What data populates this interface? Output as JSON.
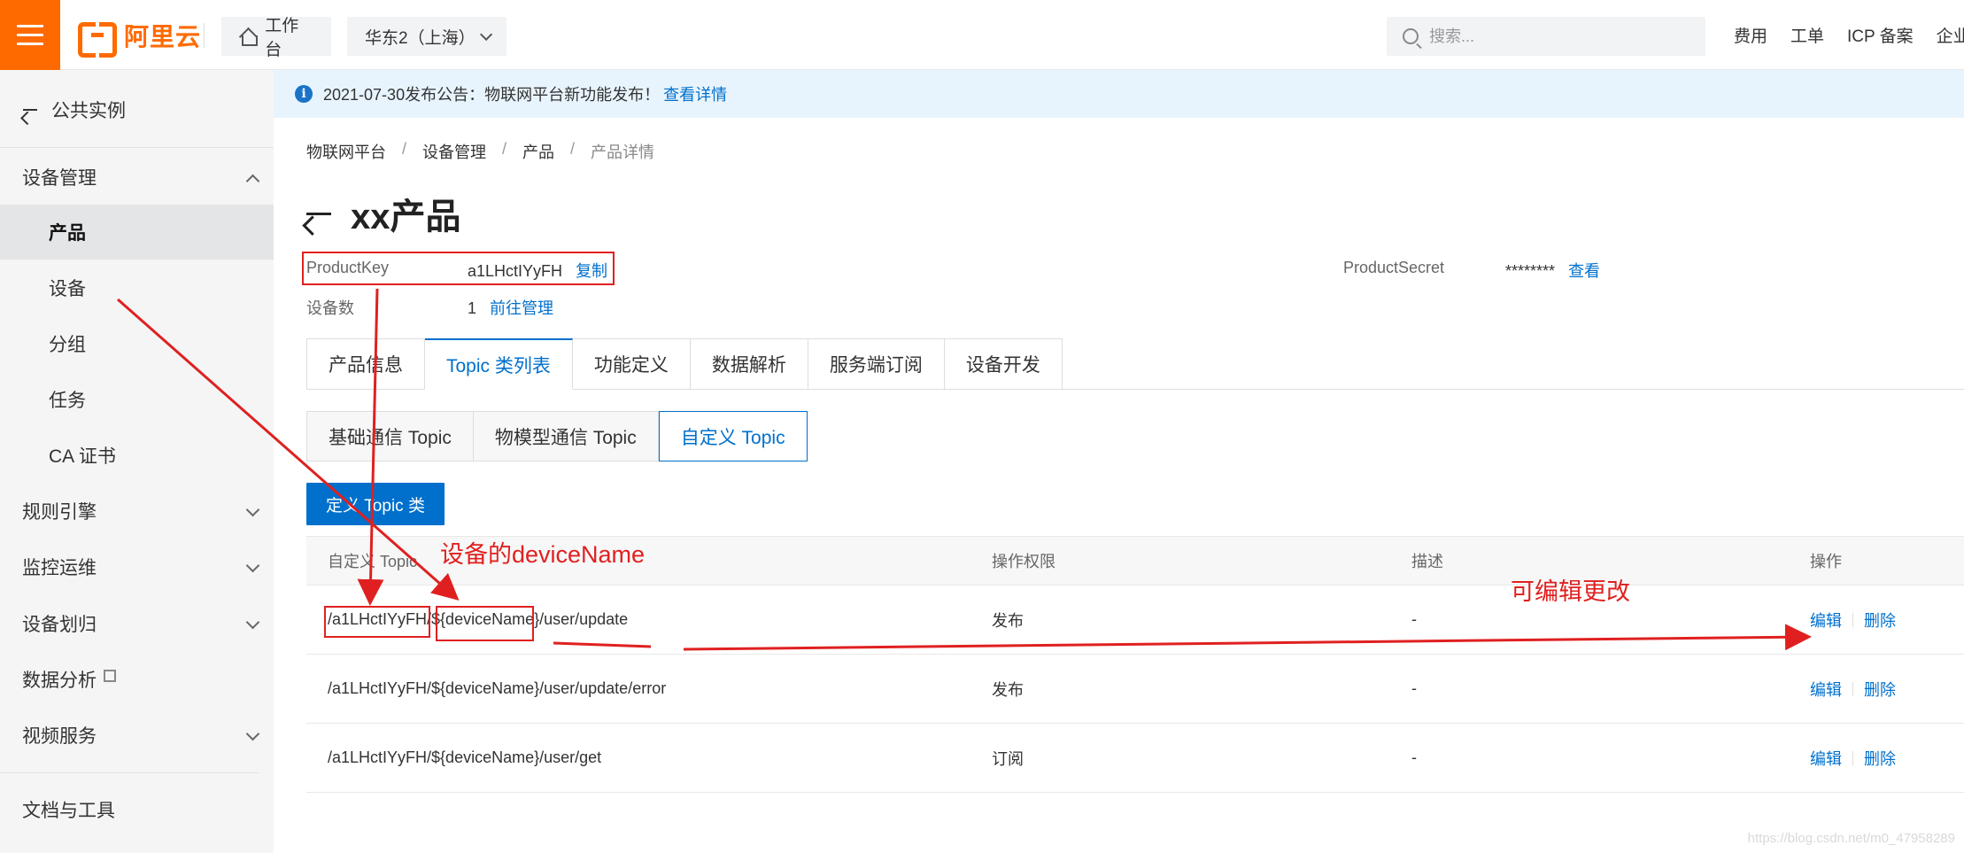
{
  "topbar": {
    "logo_text": "阿里云",
    "home_label": "工作台",
    "region_label": "华东2（上海）",
    "search_placeholder": "搜索...",
    "links": [
      "费用",
      "工单",
      "ICP 备案",
      "企业"
    ]
  },
  "sidebar": {
    "back_label": "公共实例",
    "items": [
      {
        "label": "设备管理",
        "kind": "group",
        "chevron": "up"
      },
      {
        "label": "产品",
        "kind": "sub",
        "active": true
      },
      {
        "label": "设备",
        "kind": "sub"
      },
      {
        "label": "分组",
        "kind": "sub"
      },
      {
        "label": "任务",
        "kind": "sub"
      },
      {
        "label": "CA 证书",
        "kind": "sub"
      },
      {
        "label": "规则引擎",
        "kind": "group",
        "chevron": "down"
      },
      {
        "label": "监控运维",
        "kind": "group",
        "chevron": "down"
      },
      {
        "label": "设备划归",
        "kind": "group",
        "chevron": "down"
      },
      {
        "label": "数据分析",
        "kind": "group",
        "external": true
      },
      {
        "label": "视频服务",
        "kind": "group",
        "chevron": "down"
      },
      {
        "label": "文档与工具",
        "kind": "group"
      }
    ]
  },
  "notice": {
    "text": "2021-07-30发布公告：物联网平台新功能发布！",
    "link": "查看详情"
  },
  "breadcrumb": [
    "物联网平台",
    "设备管理",
    "产品",
    "产品详情"
  ],
  "product": {
    "title": "xx产品",
    "product_key_label": "ProductKey",
    "product_key": "a1LHctIYyFH",
    "copy_label": "复制",
    "device_count_label": "设备数",
    "device_count": "1",
    "manage_link": "前往管理",
    "product_secret_label": "ProductSecret",
    "product_secret": "********",
    "view_label": "查看"
  },
  "tabs": [
    "产品信息",
    "Topic 类列表",
    "功能定义",
    "数据解析",
    "服务端订阅",
    "设备开发"
  ],
  "active_tab": 1,
  "subtabs": [
    "基础通信 Topic",
    "物模型通信 Topic",
    "自定义 Topic"
  ],
  "active_subtab": 2,
  "define_button": "定义 Topic 类",
  "table": {
    "headers": [
      "自定义 Topic",
      "操作权限",
      "描述",
      "操作"
    ],
    "rows": [
      {
        "topic": "/a1LHctIYyFH/${deviceName}/user/update",
        "perm": "发布",
        "desc": "-",
        "edit": "编辑",
        "del": "删除"
      },
      {
        "topic": "/a1LHctIYyFH/${deviceName}/user/update/error",
        "perm": "发布",
        "desc": "-",
        "edit": "编辑",
        "del": "删除"
      },
      {
        "topic": "/a1LHctIYyFH/${deviceName}/user/get",
        "perm": "订阅",
        "desc": "-",
        "edit": "编辑",
        "del": "删除"
      }
    ]
  },
  "annotations": {
    "device_name_note": "设备的deviceName",
    "editable_note": "可编辑更改",
    "color": "#e02020"
  },
  "watermark": "https://blog.csdn.net/m0_47958289",
  "colors": {
    "brand": "#ff6a00",
    "primary": "#0070cc",
    "annotation": "#e02020"
  }
}
